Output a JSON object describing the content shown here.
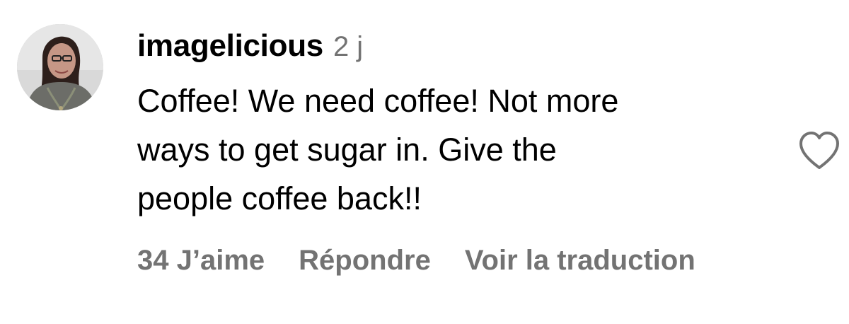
{
  "comment": {
    "username": "imagelicious",
    "time": "2 j",
    "text": "Coffee! We need coffee! Not more\nways to get sugar in. Give the\npeople coffee back!!",
    "likes_label": "34 J’aime",
    "reply_label": "Répondre",
    "translate_label": "Voir la traduction",
    "like_icon": "heart-outline-icon"
  },
  "colors": {
    "text": "#000000",
    "secondary": "#737373"
  }
}
